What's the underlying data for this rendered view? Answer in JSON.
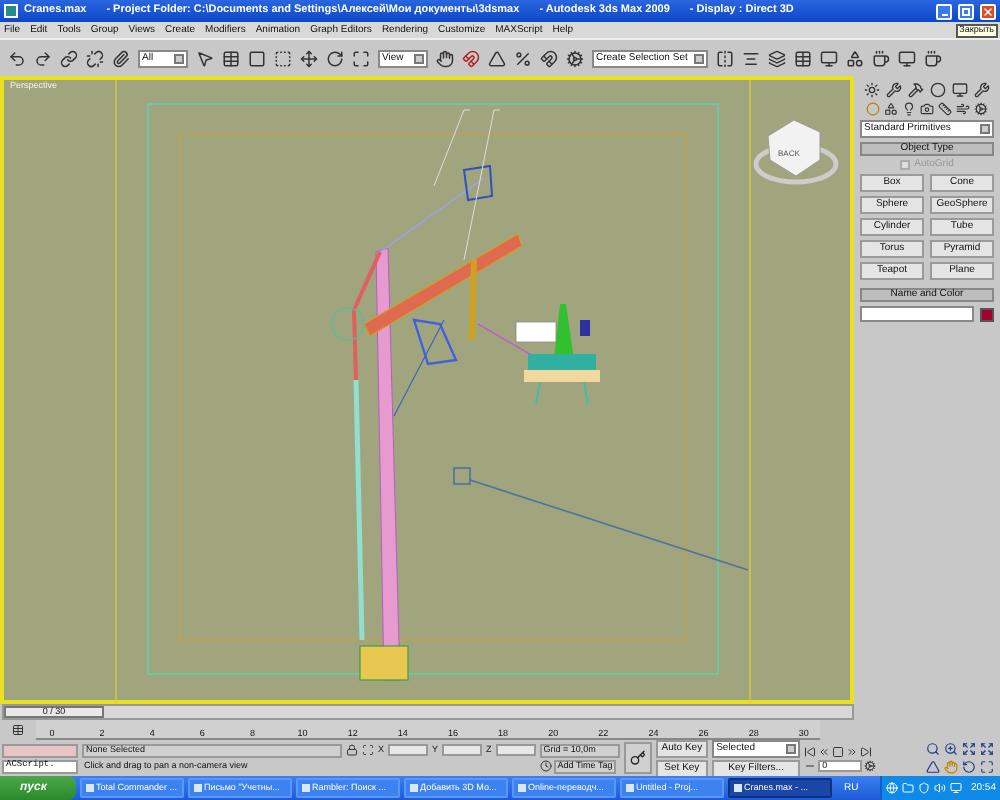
{
  "window": {
    "title_parts": [
      "Cranes.max",
      "- Project Folder: C:\\Documents and Settings\\Алексей\\Мои документы\\3dsmax",
      "- Autodesk 3ds Max  2009",
      "- Display : Direct 3D"
    ]
  },
  "menu": [
    "File",
    "Edit",
    "Tools",
    "Group",
    "Views",
    "Create",
    "Modifiers",
    "Animation",
    "Graph Editors",
    "Rendering",
    "Customize",
    "MAXScript",
    "Help"
  ],
  "tooltip": "Закрыть",
  "toolbar": {
    "filter": "All",
    "coordinate": "View",
    "selection_set": "Create Selection Set"
  },
  "viewport": {
    "label": "Perspective",
    "viewcube": "BACK"
  },
  "command_panel": {
    "category": "Standard Primitives",
    "object_type": {
      "title": "Object Type",
      "autogrid": {
        "label": "AutoGrid",
        "checked": false,
        "disabled": true
      },
      "buttons": [
        "Box",
        "Cone",
        "Sphere",
        "GeoSphere",
        "Cylinder",
        "Tube",
        "Torus",
        "Pyramid",
        "Teapot",
        "Plane"
      ]
    },
    "name_and_color": {
      "title": "Name and Color"
    }
  },
  "time_slider": {
    "label": "0 / 30",
    "level": 0
  },
  "track_bar": {
    "ticks": [
      "0",
      "2",
      "4",
      "6",
      "8",
      "10",
      "12",
      "14",
      "16",
      "18",
      "20",
      "22",
      "24",
      "26",
      "28",
      "30"
    ]
  },
  "status": {
    "selection": "None Selected",
    "prompt": "Click and drag to pan a non-camera view",
    "listener": "ACScript.",
    "coords": [
      "X",
      "Y",
      "Z"
    ],
    "grid": "Grid = 10,0m",
    "time_tag": "Add Time Tag",
    "auto_key": "Auto Key",
    "set_key": "Set Key",
    "key_mode": "Selected",
    "key_filters": "Key Filters...",
    "frame": "0"
  },
  "taskbar": {
    "start": "пуск",
    "tasks": [
      {
        "label": "Total Commander ...",
        "selected": false
      },
      {
        "label": "Письмо \"Учетны...",
        "selected": false
      },
      {
        "label": "Rambler: Поиск ...",
        "selected": false
      },
      {
        "label": "Добавить 3D Мо...",
        "selected": false
      },
      {
        "label": "Online-переводч...",
        "selected": false
      },
      {
        "label": "Untitled   - Proj...",
        "selected": false
      },
      {
        "label": "Cranes.max   - ...",
        "selected": true
      }
    ],
    "language": "RU",
    "clock": "20:54"
  }
}
